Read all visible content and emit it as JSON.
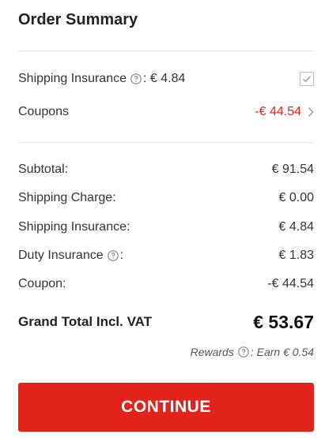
{
  "title": "Order Summary",
  "options": {
    "shipping_insurance_label": "Shipping Insurance",
    "shipping_insurance_price": ": € 4.84",
    "shipping_insurance_checked": true,
    "coupons_label": "Coupons",
    "coupons_value": "-€ 44.54"
  },
  "totals": [
    {
      "label": "Subtotal:",
      "value": "€ 91.54"
    },
    {
      "label": "Shipping Charge:",
      "value": "€ 0.00"
    },
    {
      "label": "Shipping Insurance:",
      "value": "€ 4.84"
    },
    {
      "label": "Duty Insurance",
      "suffix": ":",
      "value": "€ 1.83"
    },
    {
      "label": "Coupon:",
      "value": "-€ 44.54"
    }
  ],
  "grand_total": {
    "label": "Grand Total Incl. VAT",
    "value": "€ 53.67"
  },
  "rewards": {
    "label": "Rewards",
    "text": ": Earn € 0.54"
  },
  "continue_label": "CONTINUE",
  "colors": {
    "accent": "#e2231a",
    "divider": "#e6e6e6",
    "text": "#333333"
  },
  "icons": {
    "help": "question-circle-icon",
    "check": "check-icon",
    "chevron": "chevron-right-icon"
  }
}
